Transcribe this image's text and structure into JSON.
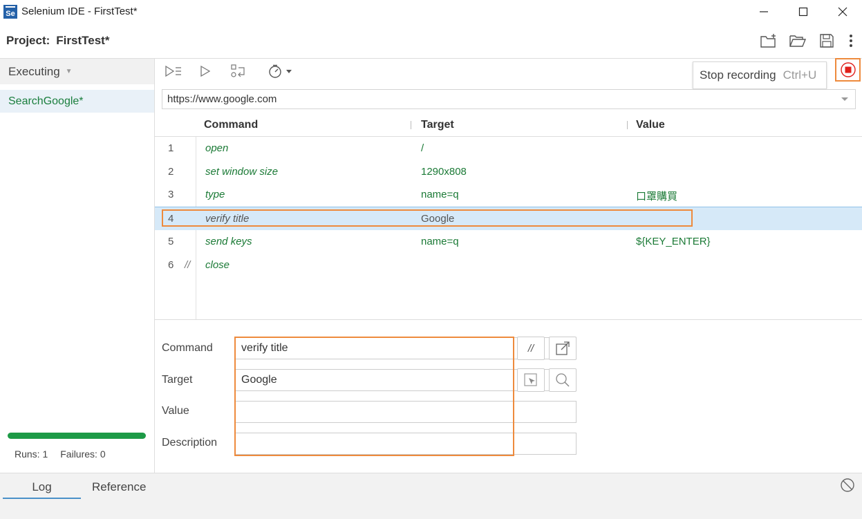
{
  "window": {
    "title": "Selenium IDE - FirstTest*",
    "icon_text": "Se"
  },
  "project": {
    "label": "Project:",
    "name": "FirstTest*"
  },
  "sidebar": {
    "header": "Executing",
    "tests": [
      {
        "name": "SearchGoogle*"
      }
    ],
    "runs_label": "Runs: 1",
    "failures_label": "Failures: 0",
    "progress": 1.0
  },
  "toolbar": {
    "tooltip_text": "Stop recording",
    "tooltip_shortcut": "Ctrl+U"
  },
  "url": "https://www.google.com",
  "table": {
    "headers": {
      "command": "Command",
      "target": "Target",
      "value": "Value"
    },
    "rows": [
      {
        "num": "1",
        "comment": "",
        "command": "open",
        "target": "/",
        "value": ""
      },
      {
        "num": "2",
        "comment": "",
        "command": "set window size",
        "target": "1290x808",
        "value": ""
      },
      {
        "num": "3",
        "comment": "",
        "command": "type",
        "target": "name=q",
        "value": "口罩購買"
      },
      {
        "num": "4",
        "comment": "",
        "command": "verify title",
        "target": "Google",
        "value": ""
      },
      {
        "num": "5",
        "comment": "",
        "command": "send keys",
        "target": "name=q",
        "value": "${KEY_ENTER}"
      },
      {
        "num": "6",
        "comment": "//",
        "command": "close",
        "target": "",
        "value": ""
      }
    ]
  },
  "editor": {
    "command_label": "Command",
    "command_value": "verify title",
    "target_label": "Target",
    "target_value": "Google",
    "value_label": "Value",
    "value_value": "",
    "description_label": "Description",
    "description_value": "",
    "comment_btn": "//"
  },
  "bottom": {
    "tabs": [
      "Log",
      "Reference"
    ]
  },
  "colors": {
    "accent_orange": "#ee8a3c",
    "green_text": "#1b7a36",
    "record_red": "#e0201c",
    "progress_green": "#1d9a46"
  }
}
